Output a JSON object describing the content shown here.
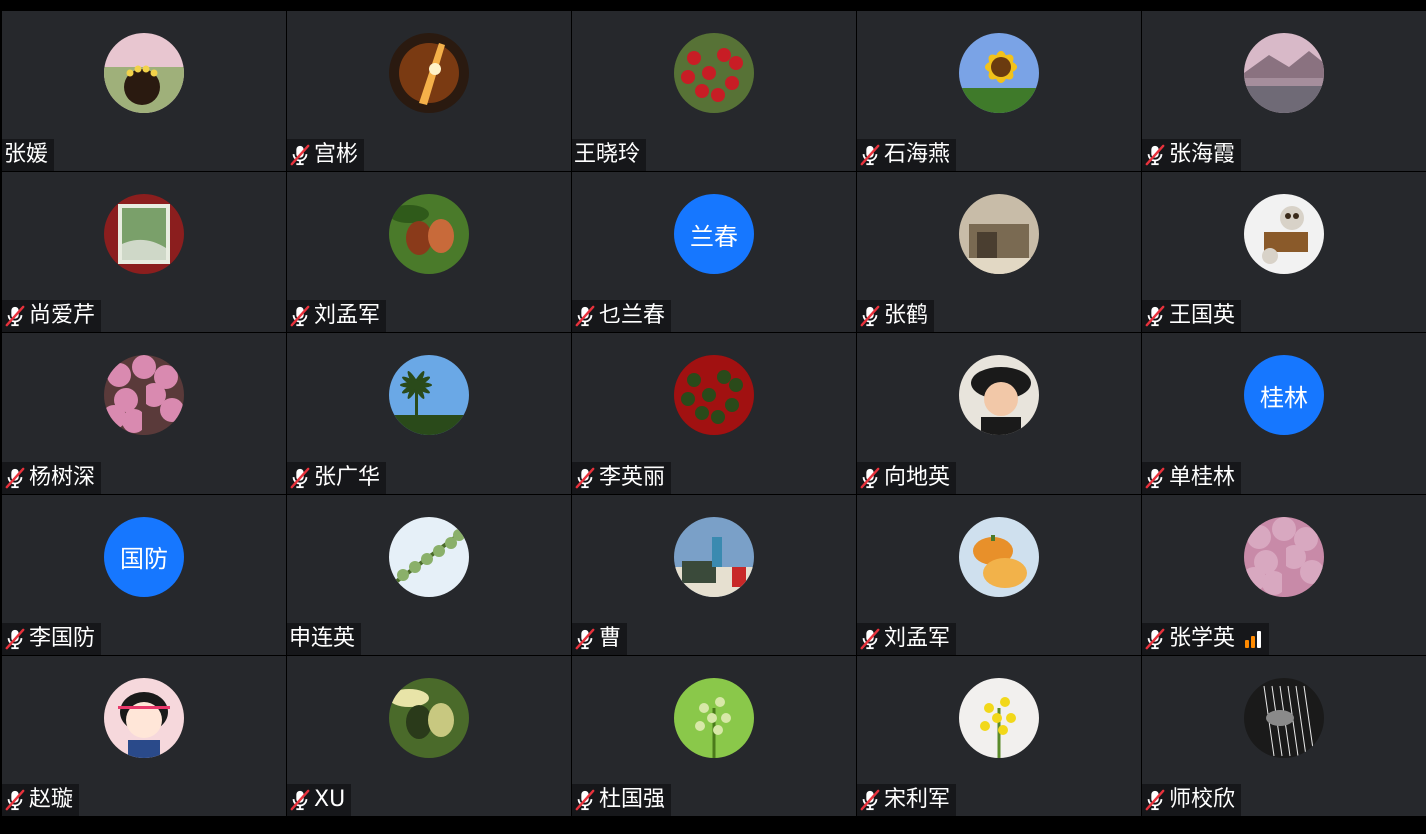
{
  "participants": [
    {
      "name": "张媛",
      "muted": false,
      "avatar": {
        "type": "photo",
        "icon": "meadow-girl-photo",
        "colors": [
          "#9fb07a",
          "#5a6a38",
          "#e8c6d0",
          "#f2d24a"
        ]
      }
    },
    {
      "name": "宫彬",
      "muted": true,
      "avatar": {
        "type": "photo",
        "icon": "space-light-photo",
        "colors": [
          "#2a1a10",
          "#7a3a12",
          "#f5b14a",
          "#fff3c8"
        ]
      }
    },
    {
      "name": "王晓玲",
      "muted": false,
      "avatar": {
        "type": "photo",
        "icon": "red-berries-photo",
        "colors": [
          "#6f8a45",
          "#3e5a26",
          "#c81d25",
          "#e8d6b0"
        ]
      }
    },
    {
      "name": "石海燕",
      "muted": true,
      "avatar": {
        "type": "photo",
        "icon": "sunflower-photo",
        "colors": [
          "#7aa3e6",
          "#3f7a2a",
          "#f2c21a",
          "#6b3b0f"
        ]
      }
    },
    {
      "name": "张海霞",
      "muted": true,
      "avatar": {
        "type": "photo",
        "icon": "lake-mountain-photo",
        "colors": [
          "#d8b9c8",
          "#8a7280",
          "#6f6a76",
          "#c9a7b6"
        ]
      }
    },
    {
      "name": "尚爱芹",
      "muted": true,
      "avatar": {
        "type": "photo",
        "icon": "framed-painting-photo",
        "colors": [
          "#8b1e1e",
          "#e8ece0",
          "#7aa06a",
          "#cfd8c8"
        ]
      }
    },
    {
      "name": "刘孟军",
      "muted": true,
      "avatar": {
        "type": "photo",
        "icon": "dates-fruit-photo",
        "colors": [
          "#4a7a2a",
          "#2f5a1a",
          "#8a3a1a",
          "#c86a3a"
        ]
      }
    },
    {
      "name": "乜兰春",
      "muted": true,
      "avatar": {
        "type": "initials",
        "text": "兰春",
        "colors": [
          "#1677ff"
        ]
      }
    },
    {
      "name": "张鹤",
      "muted": true,
      "avatar": {
        "type": "photo",
        "icon": "painting-room-photo",
        "colors": [
          "#c8bca8",
          "#7a6a52",
          "#4a3e30",
          "#e2d8c4"
        ]
      }
    },
    {
      "name": "王国英",
      "muted": true,
      "avatar": {
        "type": "photo",
        "icon": "owl-figurine-photo",
        "colors": [
          "#f2f2f2",
          "#d8d2c8",
          "#8a5a2a",
          "#3a2a1a"
        ]
      }
    },
    {
      "name": "杨树深",
      "muted": true,
      "avatar": {
        "type": "photo",
        "icon": "cherry-blossom-photo",
        "colors": [
          "#d98ab0",
          "#b06a8a",
          "#5a3a3a",
          "#f2c8dc"
        ]
      }
    },
    {
      "name": "张广华",
      "muted": true,
      "avatar": {
        "type": "photo",
        "icon": "palm-beach-photo",
        "colors": [
          "#6aa8e6",
          "#bfe0f8",
          "#2a4a1a",
          "#3a7ab0"
        ]
      }
    },
    {
      "name": "李英丽",
      "muted": true,
      "avatar": {
        "type": "photo",
        "icon": "red-roses-photo",
        "colors": [
          "#c81818",
          "#7a0a0a",
          "#2a4a1a",
          "#e84a3a"
        ]
      }
    },
    {
      "name": "向地英",
      "muted": true,
      "avatar": {
        "type": "photo",
        "icon": "smiling-girl-photo",
        "colors": [
          "#e8e4dc",
          "#1a1a1a",
          "#f2c8a8",
          "#c8a08a"
        ]
      }
    },
    {
      "name": "单桂林",
      "muted": true,
      "avatar": {
        "type": "initials",
        "text": "桂林",
        "colors": [
          "#1677ff"
        ]
      }
    },
    {
      "name": "李国防",
      "muted": true,
      "avatar": {
        "type": "initials",
        "text": "国防",
        "colors": [
          "#1677ff"
        ]
      }
    },
    {
      "name": "申连英",
      "muted": false,
      "avatar": {
        "type": "photo",
        "icon": "blossom-branch-photo",
        "colors": [
          "#e6f0f8",
          "#8ab06a",
          "#4a6a2a",
          "#c8d8e8"
        ]
      }
    },
    {
      "name": "曹",
      "muted": true,
      "avatar": {
        "type": "photo",
        "icon": "tractor-person-photo",
        "colors": [
          "#7aa0c8",
          "#3a4a3a",
          "#c82828",
          "#e6e0d0"
        ]
      }
    },
    {
      "name": "刘孟军",
      "muted": true,
      "avatar": {
        "type": "photo",
        "icon": "pumpkins-photo",
        "colors": [
          "#cfe0ee",
          "#e8902a",
          "#f2b24a",
          "#4a7a2a"
        ]
      }
    },
    {
      "name": "张学英",
      "muted": true,
      "signal": true,
      "signal_color": "#ff8a00",
      "avatar": {
        "type": "photo",
        "icon": "pink-tree-lane-photo",
        "colors": [
          "#d8a8c0",
          "#8a6a6a",
          "#c88aa8",
          "#e8d8e0"
        ]
      }
    },
    {
      "name": "赵璇",
      "muted": true,
      "avatar": {
        "type": "photo",
        "icon": "cartoon-girl-photo",
        "colors": [
          "#f6d8dc",
          "#1a1a1a",
          "#e8386a",
          "#2a4a8a"
        ]
      }
    },
    {
      "name": "XU",
      "muted": true,
      "avatar": {
        "type": "photo",
        "icon": "pear-photo",
        "colors": [
          "#4a6a2a",
          "#e8e4a8",
          "#2a3a1a",
          "#c8c880"
        ]
      }
    },
    {
      "name": "杜国强",
      "muted": true,
      "avatar": {
        "type": "photo",
        "icon": "green-buds-photo",
        "colors": [
          "#8ac84a",
          "#4a7a1a",
          "#d8e8a8",
          "#2a4a10"
        ]
      }
    },
    {
      "name": "宋利军",
      "muted": true,
      "avatar": {
        "type": "photo",
        "icon": "yellow-flowers-photo",
        "colors": [
          "#f2f0ee",
          "#5a8a2a",
          "#f2d81a",
          "#e8e0dc"
        ]
      }
    },
    {
      "name": "师校欣",
      "muted": true,
      "avatar": {
        "type": "photo",
        "icon": "guzheng-hands-photo",
        "colors": [
          "#1a1a1a",
          "#8a8a8a",
          "#e8e8e8",
          "#4a4a4a"
        ]
      }
    }
  ]
}
